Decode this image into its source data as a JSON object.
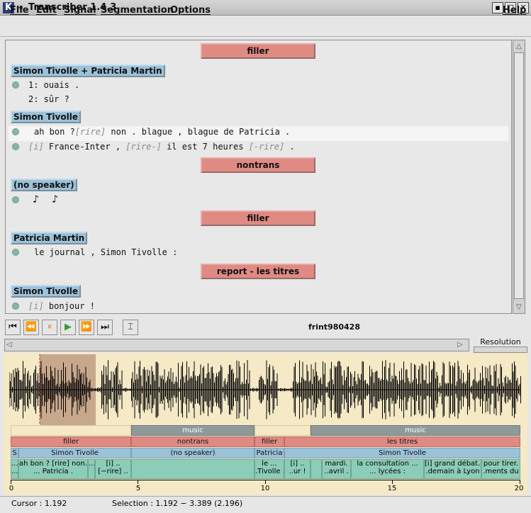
{
  "window": {
    "title": "Transcriber 1.4.3",
    "app_icon": "K",
    "pin_glyph": "⇥",
    "buttons": {
      "minimize": "▪",
      "maximize": "□",
      "close": "✕"
    }
  },
  "menu": {
    "items": [
      "File",
      "Edit",
      "Signal",
      "Segmentation",
      "Options"
    ],
    "help": "Help"
  },
  "transcript": {
    "sections": [
      "filler",
      "nontrans",
      "filler",
      "report - les titres"
    ],
    "speakers": [
      "Simon Tivolle + Patricia Martin",
      "Simon Tivolle",
      "(no speaker)",
      "Patricia Martin",
      "Simon Tivolle"
    ],
    "overlap_lines": [
      {
        "num": "1:",
        "text": " ouais ."
      },
      {
        "num": "2:",
        "text": " sûr ?"
      }
    ],
    "line_simon1_a": "ah bon ?",
    "line_simon1_b": "[rire]",
    "line_simon1_c": " non . blague , blague de Patricia .",
    "line_simon2_a": "[i]",
    "line_simon2_b": " France-Inter , ",
    "line_simon2_c": "[rire-]",
    "line_simon2_d": " il est 7 heures ",
    "line_simon2_e": "[-rire]",
    "line_simon2_f": " .",
    "music_notes": "♪  ♪",
    "line_patricia": "le journal , Simon Tivolle :",
    "line_simon3_a": "[i]",
    "line_simon3_b": " bonjour !"
  },
  "transport": {
    "filename": "frint980428",
    "buttons": [
      {
        "name": "first-icon",
        "glyph": "⏮"
      },
      {
        "name": "rewind-icon",
        "glyph": "⏪"
      },
      {
        "name": "pause-icon",
        "glyph": "⏸"
      },
      {
        "name": "play-icon",
        "glyph": "▶"
      },
      {
        "name": "forward-icon",
        "glyph": "⏩"
      },
      {
        "name": "last-icon",
        "glyph": "⏭"
      },
      {
        "name": "cursor-tool-icon",
        "glyph": "⌶"
      }
    ]
  },
  "resolution": {
    "label": "Resolution"
  },
  "segments": {
    "music": [
      "music",
      "music"
    ],
    "sections": [
      "filler",
      "nontrans",
      "filler",
      "les titres"
    ],
    "speakers": [
      "S",
      "Simon Tivolle",
      "(no speaker)",
      "Patricia",
      "Simon Tivolle"
    ],
    "turns": [
      "...\n...",
      "ah bon ? [rire] non.\n... Patricia .",
      "...",
      "[i] ..\n[−rire] ..",
      "",
      "le ...\n.Tivolle :",
      "[i] ..\n..ur !",
      "mardi.\n..avril .",
      "la consultation ...\n... lycées :",
      "[i] grand débat..\n.demain à Lyon",
      "pour tirer.\n.ments du"
    ]
  },
  "timeline": {
    "ticks": [
      "0",
      "5",
      "10",
      "15",
      "20"
    ]
  },
  "status": {
    "cursor": "Cursor : 1.192",
    "selection": "Selection : 1.192 − 3.389 (2.196)"
  },
  "colors": {
    "section": "#e08a84",
    "speaker": "#9cc2d9",
    "turn": "#8ccdb8",
    "music": "#8e9a9a",
    "signal_bg": "#f5e9c6",
    "selection": "#c8a88c"
  }
}
